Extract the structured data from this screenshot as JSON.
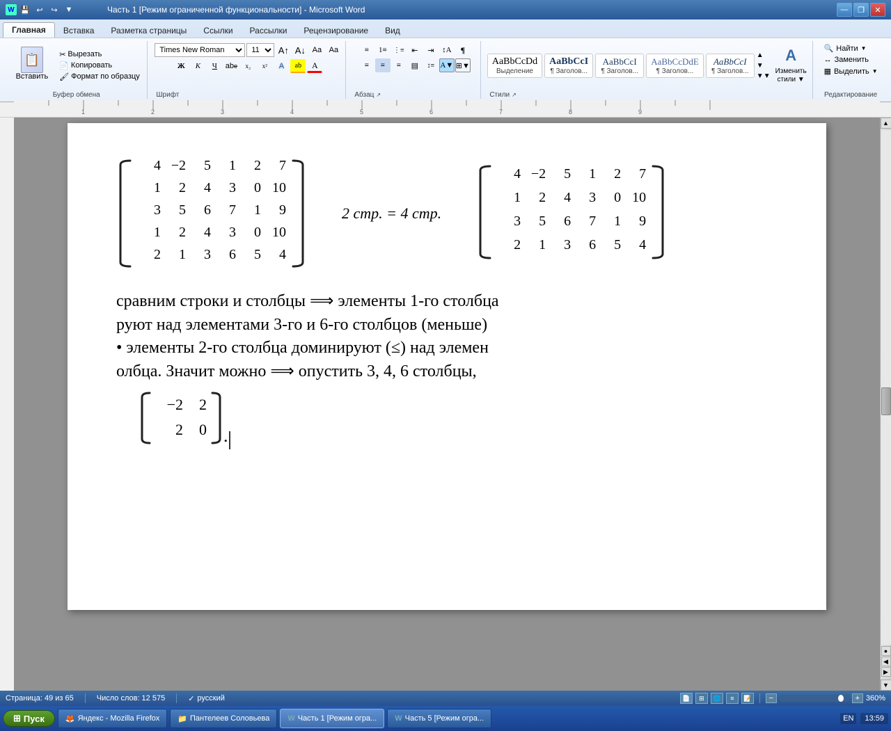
{
  "titlebar": {
    "title": "Часть 1 [Режим ограниченной функциональности] - Microsoft Word",
    "minimize": "—",
    "restore": "❐",
    "close": "✕"
  },
  "ribbon": {
    "tabs": [
      "Главная",
      "Вставка",
      "Разметка страницы",
      "Ссылки",
      "Рассылки",
      "Рецензирование",
      "Вид"
    ],
    "active_tab": "Главная",
    "groups": {
      "clipboard": {
        "label": "Буфер обмена",
        "paste_label": "Вставить",
        "cut": "Вырезать",
        "copy": "Копировать",
        "format_paint": "Формат по образцу"
      },
      "font": {
        "label": "Шрифт",
        "name": "Times New Roman",
        "size": "11",
        "bold": "Ж",
        "italic": "К",
        "underline": "Ч"
      },
      "paragraph": {
        "label": "Абзац"
      },
      "styles": {
        "label": "Стили",
        "items": [
          {
            "name": "Выделение",
            "preview": "AaBbCcDd"
          },
          {
            "name": "¶ Заголов...",
            "preview": "AaBbCcI"
          },
          {
            "name": "¶ Заголов...",
            "preview": "AaBbCcI"
          },
          {
            "name": "¶ Заголов...",
            "preview": "AaBbCcDdE"
          },
          {
            "name": "¶ Заголов...",
            "preview": "AaBbCcI"
          }
        ]
      },
      "editing": {
        "label": "Редактирование",
        "find": "Найти",
        "replace": "Заменить",
        "select": "Выделить"
      }
    }
  },
  "document": {
    "matrix1": {
      "rows": [
        [
          "4",
          "−2",
          "5",
          "1",
          "2",
          "7"
        ],
        [
          "1",
          "2",
          "4",
          "3",
          "0",
          "10"
        ],
        [
          "3",
          "5",
          "6",
          "7",
          "1",
          "9"
        ],
        [
          "1",
          "2",
          "4",
          "3",
          "0",
          "10"
        ],
        [
          "2",
          "1",
          "3",
          "6",
          "5",
          "4"
        ]
      ]
    },
    "equation_text": "2 стр. = 4 стр.",
    "matrix2": {
      "rows": [
        [
          "4",
          "−2",
          "5",
          "1",
          "2",
          "7"
        ],
        [
          "1",
          "2",
          "4",
          "3",
          "0",
          "10"
        ],
        [
          "3",
          "5",
          "6",
          "7",
          "1",
          "9"
        ],
        [
          "2",
          "1",
          "3",
          "6",
          "5",
          "4"
        ]
      ]
    },
    "para1": "сравним строки и столбцы ⟹ элементы 1-го столбца",
    "para2": "руют над элементами 3-го и 6-го столбцов (меньше)",
    "para3": "• элементы 2-го столбца доминируют (≤) над элемен",
    "para4": "олбца. Значит можно ⟹ опустить 3, 4, 6 столбцы,",
    "bottom_matrix": {
      "rows": [
        [
          "−2",
          "2"
        ],
        [
          "2",
          "0"
        ]
      ]
    }
  },
  "statusbar": {
    "page": "Страница: 49 из 65",
    "words": "Число слов: 12 575",
    "lang": "русский",
    "zoom": "360%"
  },
  "taskbar": {
    "start": "Пуск",
    "items": [
      {
        "label": "Яндекс - Mozilla Firefox",
        "type": "firefox"
      },
      {
        "label": "Пантелеев Соловьева",
        "type": "folder"
      },
      {
        "label": "Часть 1 [Режим огра...",
        "type": "word"
      },
      {
        "label": "Часть 5 [Режим огра...",
        "type": "word"
      }
    ],
    "lang": "EN",
    "time": "13:59"
  }
}
